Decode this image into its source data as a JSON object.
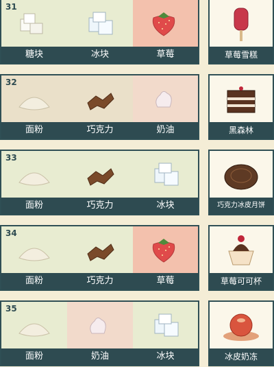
{
  "colors": {
    "bar": "#2e4b51",
    "bg_green": "#e8ecd1",
    "bg_pink": "#f2dacb",
    "bg_red": "#f3c1ad",
    "bg_tan": "#eae0c9"
  },
  "recipes": [
    {
      "number": "31",
      "ingredients": [
        {
          "name": "糖块",
          "icon": "sugar-cube-icon",
          "bg": "green"
        },
        {
          "name": "冰块",
          "icon": "ice-cube-icon",
          "bg": "green"
        },
        {
          "name": "草莓",
          "icon": "strawberry-icon",
          "bg": "red"
        }
      ],
      "result": {
        "name": "草莓雪糕",
        "icon": "strawberry-popsicle-icon"
      }
    },
    {
      "number": "32",
      "ingredients": [
        {
          "name": "面粉",
          "icon": "flour-icon",
          "bg": "tan"
        },
        {
          "name": "巧克力",
          "icon": "chocolate-icon",
          "bg": "tan"
        },
        {
          "name": "奶油",
          "icon": "cream-icon",
          "bg": "pink"
        }
      ],
      "result": {
        "name": "黑森林",
        "icon": "black-forest-cake-icon"
      }
    },
    {
      "number": "33",
      "ingredients": [
        {
          "name": "面粉",
          "icon": "flour-icon",
          "bg": "green"
        },
        {
          "name": "巧克力",
          "icon": "chocolate-icon",
          "bg": "green"
        },
        {
          "name": "冰块",
          "icon": "ice-cube-icon",
          "bg": "green"
        }
      ],
      "result": {
        "name": "巧克力冰皮月饼",
        "icon": "chocolate-mooncake-icon"
      }
    },
    {
      "number": "34",
      "ingredients": [
        {
          "name": "面粉",
          "icon": "flour-icon",
          "bg": "green"
        },
        {
          "name": "巧克力",
          "icon": "chocolate-icon",
          "bg": "green"
        },
        {
          "name": "草莓",
          "icon": "strawberry-icon",
          "bg": "red"
        }
      ],
      "result": {
        "name": "草莓可可杯",
        "icon": "strawberry-cocoa-cup-icon"
      }
    },
    {
      "number": "35",
      "ingredients": [
        {
          "name": "面粉",
          "icon": "flour-icon",
          "bg": "green"
        },
        {
          "name": "奶油",
          "icon": "cream-icon",
          "bg": "pink"
        },
        {
          "name": "冰块",
          "icon": "ice-cube-icon",
          "bg": "green"
        }
      ],
      "result": {
        "name": "冰皮奶冻",
        "icon": "snowskin-pudding-icon"
      }
    }
  ]
}
